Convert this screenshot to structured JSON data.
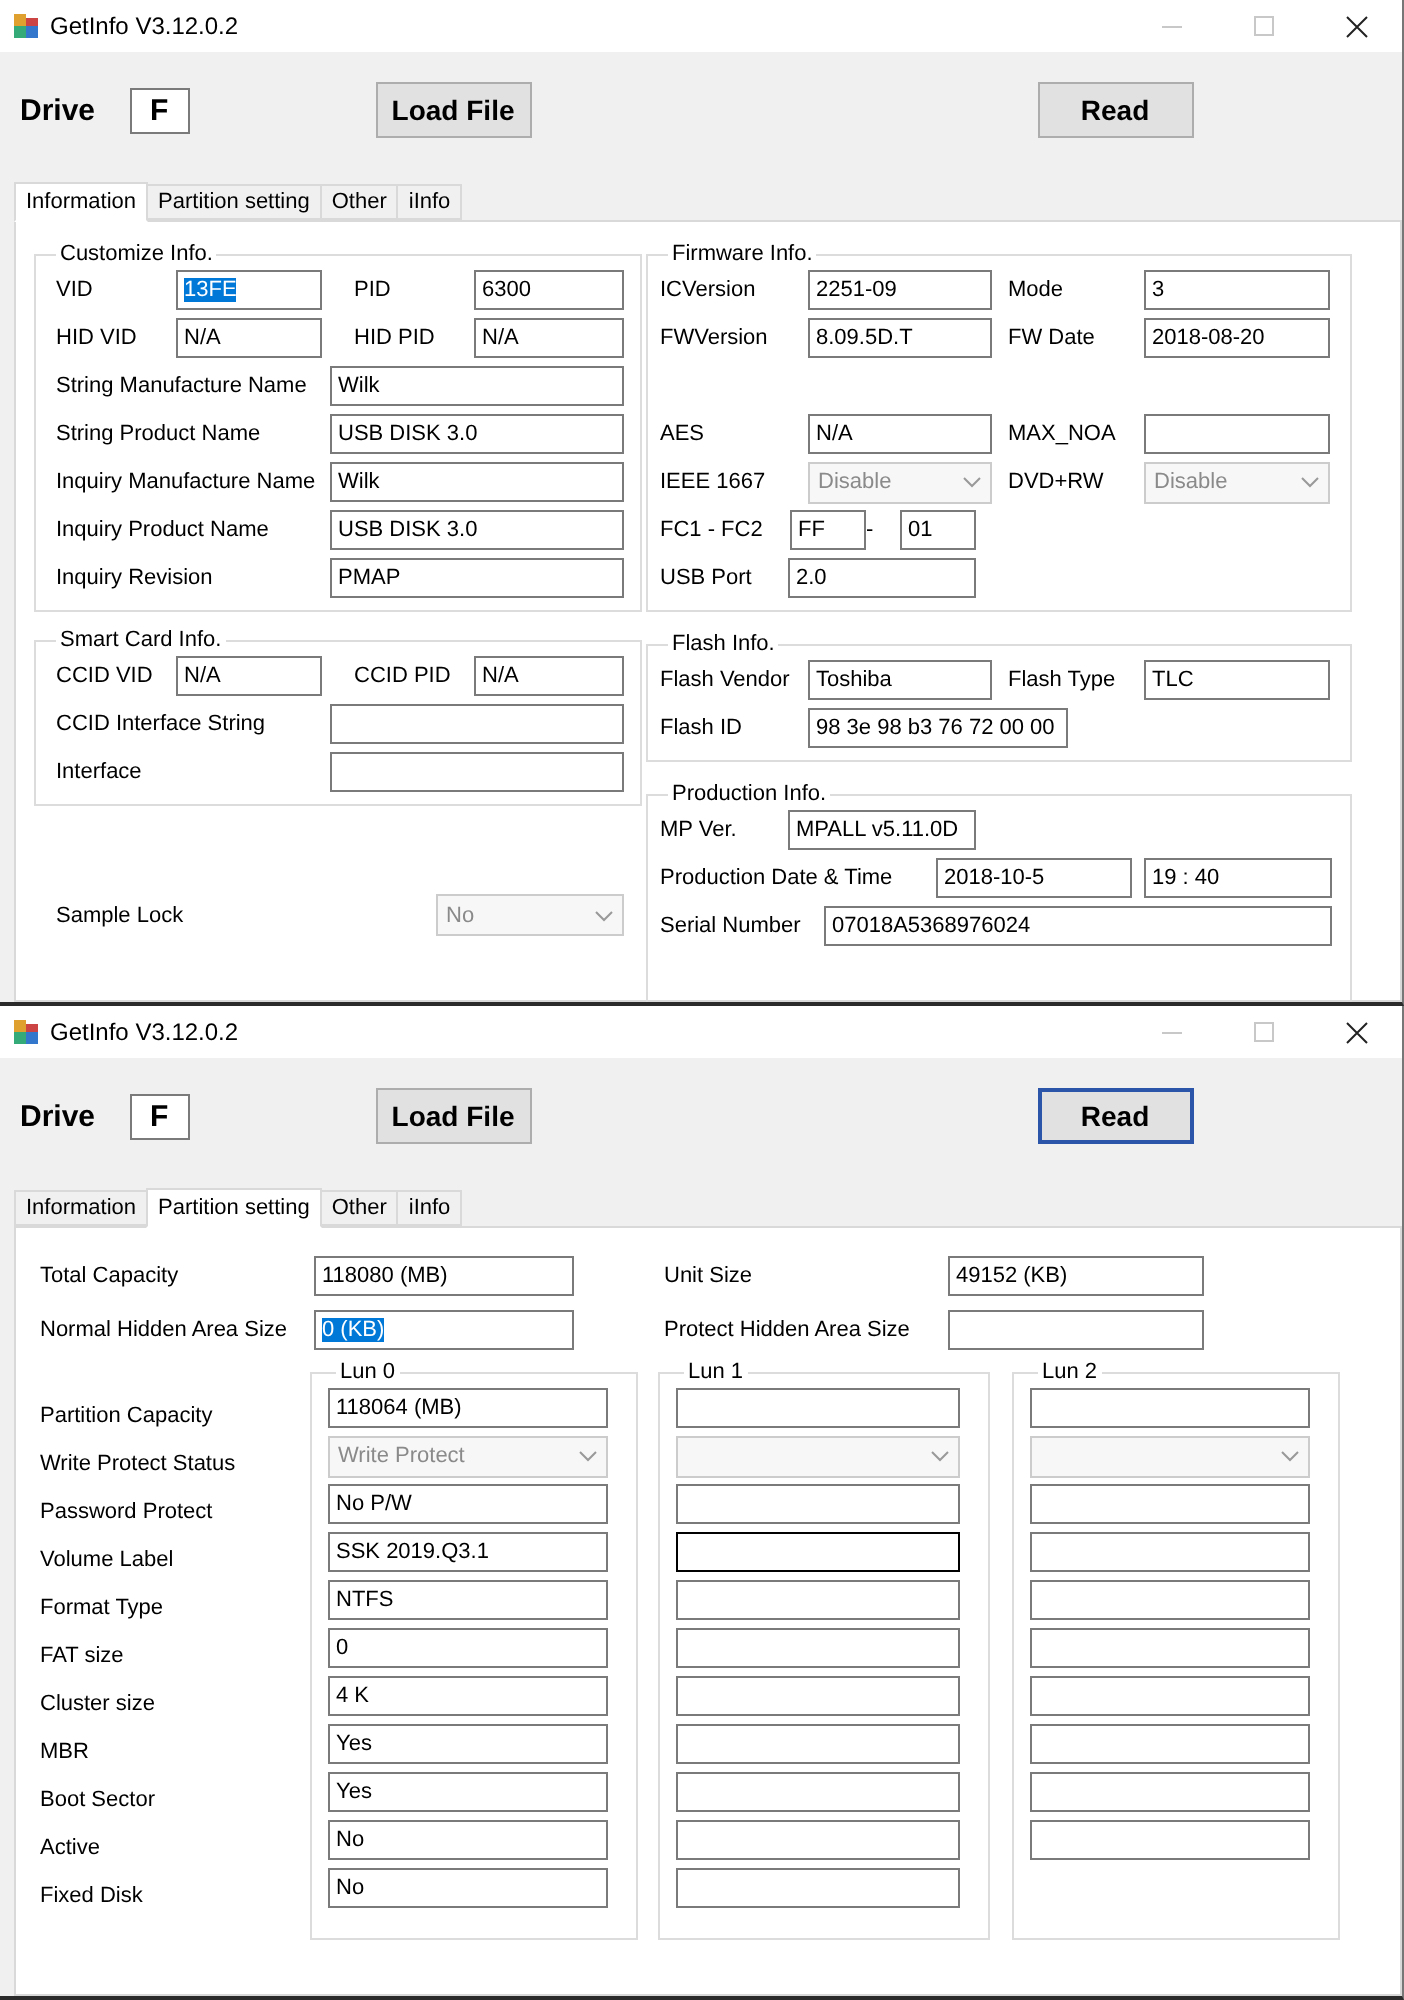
{
  "windows": [
    {
      "title": "GetInfo V3.12.0.2",
      "drive": {
        "label": "Drive",
        "value": "F"
      },
      "buttons": [
        {
          "label": "Load File",
          "focused": false
        },
        {
          "label": "Read",
          "focused": false
        }
      ],
      "tabs": [
        {
          "label": "Information",
          "selected": true
        },
        {
          "label": "Partition setting",
          "selected": false
        },
        {
          "label": "Other",
          "selected": false
        },
        {
          "label": "iInfo",
          "selected": false
        }
      ],
      "panel": {
        "kind": "information",
        "left_groups": [
          {
            "title": "Customize Info.",
            "rows": [
              {
                "kind": "pair",
                "items": [
                  {
                    "kind": "label",
                    "text": "VID"
                  },
                  {
                    "kind": "field",
                    "value": "13FE",
                    "selected": true
                  },
                  {
                    "kind": "label",
                    "text": "PID"
                  },
                  {
                    "kind": "field",
                    "value": "6300",
                    "selected": false
                  }
                ]
              },
              {
                "kind": "pair",
                "items": [
                  {
                    "kind": "label",
                    "text": "HID VID"
                  },
                  {
                    "kind": "field",
                    "value": "N/A",
                    "selected": false
                  },
                  {
                    "kind": "label",
                    "text": "HID PID"
                  },
                  {
                    "kind": "field",
                    "value": "N/A",
                    "selected": false
                  }
                ]
              },
              {
                "kind": "long",
                "items": [
                  {
                    "kind": "label",
                    "text": "String Manufacture Name"
                  },
                  {
                    "kind": "field",
                    "value": "Wilk",
                    "selected": false
                  }
                ]
              },
              {
                "kind": "long",
                "items": [
                  {
                    "kind": "label",
                    "text": "String Product Name"
                  },
                  {
                    "kind": "field",
                    "value": "USB DISK 3.0",
                    "selected": false
                  }
                ]
              },
              {
                "kind": "long",
                "items": [
                  {
                    "kind": "label",
                    "text": "Inquiry Manufacture Name"
                  },
                  {
                    "kind": "field",
                    "value": "Wilk",
                    "selected": false
                  }
                ]
              },
              {
                "kind": "long",
                "items": [
                  {
                    "kind": "label",
                    "text": "Inquiry Product Name"
                  },
                  {
                    "kind": "field",
                    "value": "USB DISK 3.0",
                    "selected": false
                  }
                ]
              },
              {
                "kind": "long",
                "items": [
                  {
                    "kind": "label",
                    "text": "Inquiry Revision"
                  },
                  {
                    "kind": "field",
                    "value": "PMAP",
                    "selected": false
                  }
                ]
              }
            ]
          },
          {
            "title": "Smart Card Info.",
            "rows": [
              {
                "kind": "pair",
                "items": [
                  {
                    "kind": "label",
                    "text": "CCID VID"
                  },
                  {
                    "kind": "field",
                    "value": "N/A"
                  },
                  {
                    "kind": "label",
                    "text": "CCID PID"
                  },
                  {
                    "kind": "field",
                    "value": "N/A"
                  }
                ]
              },
              {
                "kind": "long",
                "items": [
                  {
                    "kind": "label",
                    "text": "CCID Interface String"
                  },
                  {
                    "kind": "field"
                  }
                ]
              },
              {
                "kind": "long",
                "items": [
                  {
                    "kind": "label",
                    "text": "Interface"
                  },
                  {
                    "kind": "field"
                  }
                ]
              }
            ]
          }
        ],
        "sample_lock": {
          "label": "Sample Lock",
          "value": "No",
          "disabled": true
        },
        "right_groups": [
          {
            "title": "Firmware Info.",
            "rows": [
              {
                "kind": "pair",
                "items": [
                  {
                    "kind": "label",
                    "text": "ICVersion"
                  },
                  {
                    "kind": "field",
                    "value": "2251-09"
                  },
                  {
                    "kind": "label",
                    "text": "Mode"
                  },
                  {
                    "kind": "field",
                    "value": "3"
                  }
                ]
              },
              {
                "kind": "pair",
                "items": [
                  {
                    "kind": "label",
                    "text": "FWVersion"
                  },
                  {
                    "kind": "field",
                    "value": "8.09.5D.T"
                  },
                  {
                    "kind": "label",
                    "text": "FW Date"
                  },
                  {
                    "kind": "field",
                    "value": "2018-08-20"
                  }
                ]
              },
              {
                "kind": "blank",
                "items": []
              },
              {
                "kind": "pair",
                "items": [
                  {
                    "kind": "label",
                    "text": "AES"
                  },
                  {
                    "kind": "field",
                    "value": "N/A"
                  },
                  {
                    "kind": "label",
                    "text": "MAX_NOA"
                  },
                  {
                    "kind": "field"
                  }
                ]
              },
              {
                "kind": "pair",
                "items": [
                  {
                    "kind": "label",
                    "text": "IEEE 1667"
                  },
                  {
                    "kind": "dropdown",
                    "value": "Disable",
                    "disabled": true
                  },
                  {
                    "kind": "label",
                    "text": "DVD+RW"
                  },
                  {
                    "kind": "dropdown",
                    "value": "Disable",
                    "disabled": true
                  }
                ]
              },
              {
                "kind": "range",
                "items": [
                  {
                    "kind": "label",
                    "text": "FC1 - FC2"
                  },
                  {
                    "kind": "field",
                    "value": "FF"
                  },
                  {
                    "kind": "dash",
                    "text": "-"
                  },
                  {
                    "kind": "field",
                    "value": "01"
                  }
                ]
              },
              {
                "kind": "single",
                "items": [
                  {
                    "kind": "label",
                    "text": "USB Port"
                  },
                  {
                    "kind": "field",
                    "value": "2.0"
                  }
                ]
              }
            ]
          },
          {
            "title": "Flash Info.",
            "rows": [
              {
                "kind": "pair",
                "items": [
                  {
                    "kind": "label",
                    "text": "Flash Vendor"
                  },
                  {
                    "kind": "field",
                    "value": "Toshiba"
                  },
                  {
                    "kind": "label",
                    "text": "Flash Type"
                  },
                  {
                    "kind": "field",
                    "value": "TLC"
                  }
                ]
              },
              {
                "kind": "wide_single",
                "items": [
                  {
                    "kind": "label",
                    "text": "Flash ID"
                  },
                  {
                    "kind": "field",
                    "value": "98 3e 98 b3 76 72 00 00"
                  }
                ]
              }
            ]
          },
          {
            "title": "Production Info.",
            "rows": [
              {
                "kind": "single",
                "items": [
                  {
                    "kind": "label",
                    "text": "MP Ver."
                  },
                  {
                    "kind": "field",
                    "value": "MPALL v5.11.0D"
                  }
                ]
              },
              {
                "kind": "datetime",
                "items": [
                  {
                    "kind": "label",
                    "text": "Production Date & Time"
                  },
                  {
                    "kind": "field",
                    "value": "2018-10-5"
                  },
                  {
                    "kind": "field",
                    "value": "19 : 40"
                  }
                ]
              },
              {
                "kind": "long",
                "items": [
                  {
                    "kind": "label",
                    "text": "Serial Number"
                  },
                  {
                    "kind": "field",
                    "value": "07018A5368976024"
                  }
                ]
              }
            ]
          }
        ]
      }
    },
    {
      "title": "GetInfo V3.12.0.2",
      "drive": {
        "label": "Drive",
        "value": "F"
      },
      "buttons": [
        {
          "label": "Load File",
          "focused": false
        },
        {
          "label": "Read",
          "focused": true
        }
      ],
      "tabs": [
        {
          "label": "Information",
          "selected": false
        },
        {
          "label": "Partition setting",
          "selected": true
        },
        {
          "label": "Other",
          "selected": false
        },
        {
          "label": "iInfo",
          "selected": false
        }
      ],
      "panel": {
        "kind": "partition",
        "capacity": [
          {
            "label": "Total Capacity",
            "value": "118080 (MB)",
            "selected": false
          },
          {
            "label": "Unit Size",
            "value": "49152 (KB)",
            "selected": false
          },
          {
            "label": "Normal Hidden Area Size",
            "value": "0 (KB)",
            "selected": true
          },
          {
            "label": "Protect Hidden Area Size"
          }
        ],
        "row_labels": [
          "Partition Capacity",
          "Write Protect Status",
          "Password Protect",
          "Volume Label",
          "Format Type",
          "FAT size",
          "Cluster size",
          "MBR",
          "Boot Sector",
          "Active",
          "Fixed Disk"
        ],
        "luns": [
          {
            "title": "Lun 0",
            "cells": [
              {
                "kind": "field",
                "value": "118064 (MB)"
              },
              {
                "kind": "dropdown",
                "value": "Write Protect",
                "disabled": true
              },
              {
                "kind": "field",
                "value": "No P/W"
              },
              {
                "kind": "field",
                "value": "SSK 2019.Q3.1"
              },
              {
                "kind": "field",
                "value": "NTFS"
              },
              {
                "kind": "field",
                "value": "0"
              },
              {
                "kind": "field",
                "value": "4 K"
              },
              {
                "kind": "field",
                "value": "Yes"
              },
              {
                "kind": "field",
                "value": "Yes"
              },
              {
                "kind": "field",
                "value": "No"
              },
              {
                "kind": "field",
                "value": "No"
              }
            ]
          },
          {
            "title": "Lun 1",
            "cells": [
              {
                "kind": "field",
                "focused": false
              },
              {
                "kind": "dropdown",
                "disabled": true
              },
              {
                "kind": "field",
                "focused": false
              },
              {
                "kind": "field",
                "focused": true
              },
              {
                "kind": "field",
                "focused": false
              },
              {
                "kind": "field",
                "focused": false
              },
              {
                "kind": "field",
                "focused": false
              },
              {
                "kind": "field",
                "focused": false
              },
              {
                "kind": "field",
                "focused": false
              },
              {
                "kind": "field",
                "focused": false
              },
              {
                "kind": "field",
                "focused": false
              }
            ]
          },
          {
            "title": "Lun 2",
            "cells": [
              {
                "kind": "field"
              },
              {
                "kind": "dropdown",
                "disabled": true
              },
              {
                "kind": "field"
              },
              {
                "kind": "field"
              },
              {
                "kind": "field"
              },
              {
                "kind": "field"
              },
              {
                "kind": "field"
              },
              {
                "kind": "field"
              },
              {
                "kind": "field"
              },
              {
                "kind": "field"
              }
            ]
          }
        ]
      }
    }
  ]
}
